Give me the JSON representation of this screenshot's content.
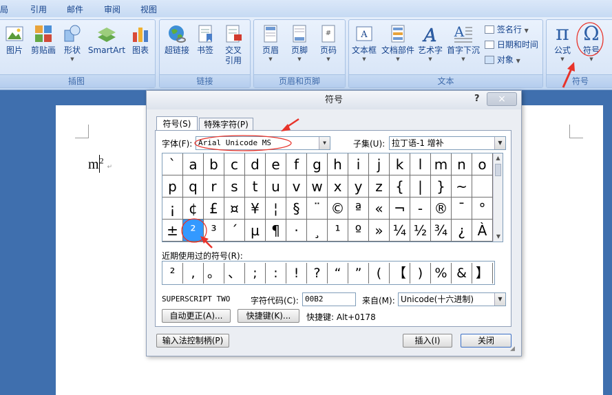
{
  "ribbon": {
    "tabs": [
      "引用",
      "邮件",
      "审阅",
      "视图"
    ],
    "tab_partial": "局",
    "groups": {
      "illustrations": {
        "label": "插图",
        "buttons": [
          "图片",
          "剪贴画",
          "形状",
          "SmartArt",
          "图表"
        ]
      },
      "links": {
        "label": "链接",
        "buttons": [
          "超链接",
          "书签",
          "交叉",
          "引用"
        ]
      },
      "header_footer": {
        "label": "页眉和页脚",
        "buttons": [
          "页眉",
          "页脚",
          "页码"
        ]
      },
      "text": {
        "label": "文本",
        "buttons": [
          "文本框",
          "文档部件",
          "艺术字",
          "首字下沉"
        ],
        "small": [
          "签名行",
          "日期和时间",
          "对象"
        ]
      },
      "symbols": {
        "label": "符号",
        "buttons": [
          "公式",
          "符号"
        ]
      }
    }
  },
  "document": {
    "text": "m",
    "superscript": "2"
  },
  "dialog": {
    "title": "符号",
    "help": "?",
    "close": "×",
    "tabs": [
      "符号(S)",
      "特殊字符(P)"
    ],
    "font_label": "字体(F):",
    "font_value": "Arial Unicode MS",
    "subset_label": "子集(U):",
    "subset_value": "拉丁语-1 增补",
    "symbols": [
      "`",
      "a",
      "b",
      "c",
      "d",
      "e",
      "f",
      "g",
      "h",
      "i",
      "j",
      "k",
      "l",
      "m",
      "n",
      "o",
      "p",
      "q",
      "r",
      "s",
      "t",
      "u",
      "v",
      "w",
      "x",
      "y",
      "z",
      "{",
      "|",
      "}",
      "~",
      "",
      "¡",
      "¢",
      "£",
      "¤",
      "¥",
      "¦",
      "§",
      "¨",
      "©",
      "ª",
      "«",
      "¬",
      "-",
      "®",
      "¯",
      "°",
      "±",
      "²",
      "³",
      "´",
      "µ",
      "¶",
      "·",
      "¸",
      "¹",
      "º",
      "»",
      "¼",
      "½",
      "¾",
      "¿",
      "À"
    ],
    "selected_symbol": "²",
    "recent_label": "近期使用过的符号(R):",
    "recent": [
      "²",
      ",",
      "。",
      "、",
      ";",
      ":",
      "!",
      "?",
      "“",
      "”",
      "(",
      "【",
      ")",
      "%",
      "&",
      "】"
    ],
    "char_name": "SUPERSCRIPT TWO",
    "char_code_label": "字符代码(C):",
    "char_code_value": "00B2",
    "from_label": "来自(M):",
    "from_value": "Unicode(十六进制)",
    "autocorrect_button": "自动更正(A)...",
    "shortcut_key_button": "快捷键(K)...",
    "shortcut_text": "快捷键: Alt+0178",
    "ime_button": "输入法控制柄(P)",
    "insert_button": "插入(I)",
    "close_button": "关闭"
  },
  "colors": {
    "selected": "#3399ff",
    "annotation": "#e8332a"
  }
}
